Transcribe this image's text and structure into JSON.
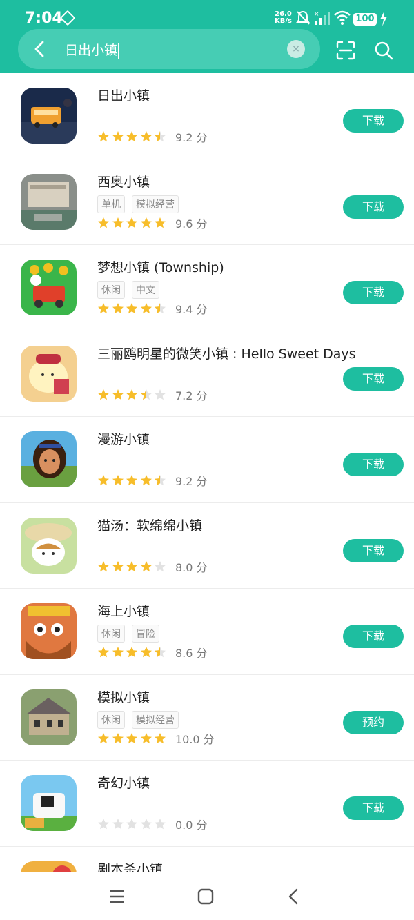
{
  "status": {
    "time": "7:04",
    "speed_top": "26.0",
    "speed_bottom": "KB/s",
    "battery": "100"
  },
  "search": {
    "query": "日出小镇"
  },
  "apps": [
    {
      "title": "日出小镇",
      "tags": [],
      "stars": 4.5,
      "score": "9.2 分",
      "button": "下载",
      "icon": {
        "bg": "#1a2a4a",
        "accent": "#f0a030"
      }
    },
    {
      "title": "西奥小镇",
      "tags": [
        "单机",
        "模拟经营"
      ],
      "stars": 5,
      "score": "9.6 分",
      "button": "下载",
      "icon": {
        "bg": "#8a8f8a",
        "accent": "#d8d0c0"
      }
    },
    {
      "title": "梦想小镇 (Township)",
      "tags": [
        "休闲",
        "中文"
      ],
      "stars": 4.5,
      "score": "9.4 分",
      "button": "下载",
      "icon": {
        "bg": "#3ab54a",
        "accent": "#e0402a"
      }
    },
    {
      "title": "三丽鸥明星的微笑小镇 : Hello Sweet Days",
      "tags": [],
      "stars": 3.5,
      "score": "7.2 分",
      "button": "下载",
      "icon": {
        "bg": "#f4d090",
        "accent": "#d04050"
      }
    },
    {
      "title": "漫游小镇",
      "tags": [],
      "stars": 4.5,
      "score": "9.2 分",
      "button": "下载",
      "icon": {
        "bg": "#d89060",
        "accent": "#5a3020"
      }
    },
    {
      "title": "猫汤：软绵绵小镇",
      "tags": [],
      "stars": 4,
      "score": "8.0 分",
      "button": "下载",
      "icon": {
        "bg": "#e8d8a8",
        "accent": "#d09040"
      }
    },
    {
      "title": "海上小镇",
      "tags": [
        "休闲",
        "冒险"
      ],
      "stars": 4.5,
      "score": "8.6 分",
      "button": "下载",
      "icon": {
        "bg": "#e07840",
        "accent": "#f0c030"
      }
    },
    {
      "title": "模拟小镇",
      "tags": [
        "休闲",
        "模拟经营"
      ],
      "stars": 5,
      "score": "10.0 分",
      "button": "预约",
      "icon": {
        "bg": "#6a6060",
        "accent": "#c0b090"
      }
    },
    {
      "title": "奇幻小镇",
      "tags": [],
      "stars": 0,
      "score": "0.0 分",
      "button": "下载",
      "icon": {
        "bg": "#7ac8f0",
        "accent": "#f8f8f8"
      }
    },
    {
      "title": "剧本杀小镇",
      "tags": [],
      "stars": 0,
      "score": "",
      "button": "",
      "icon": {
        "bg": "#f0b040",
        "accent": "#e04040"
      }
    }
  ],
  "colors": {
    "primary": "#1ebea0",
    "star_on": "#f7bd2a",
    "star_off": "#e2e2e2"
  }
}
